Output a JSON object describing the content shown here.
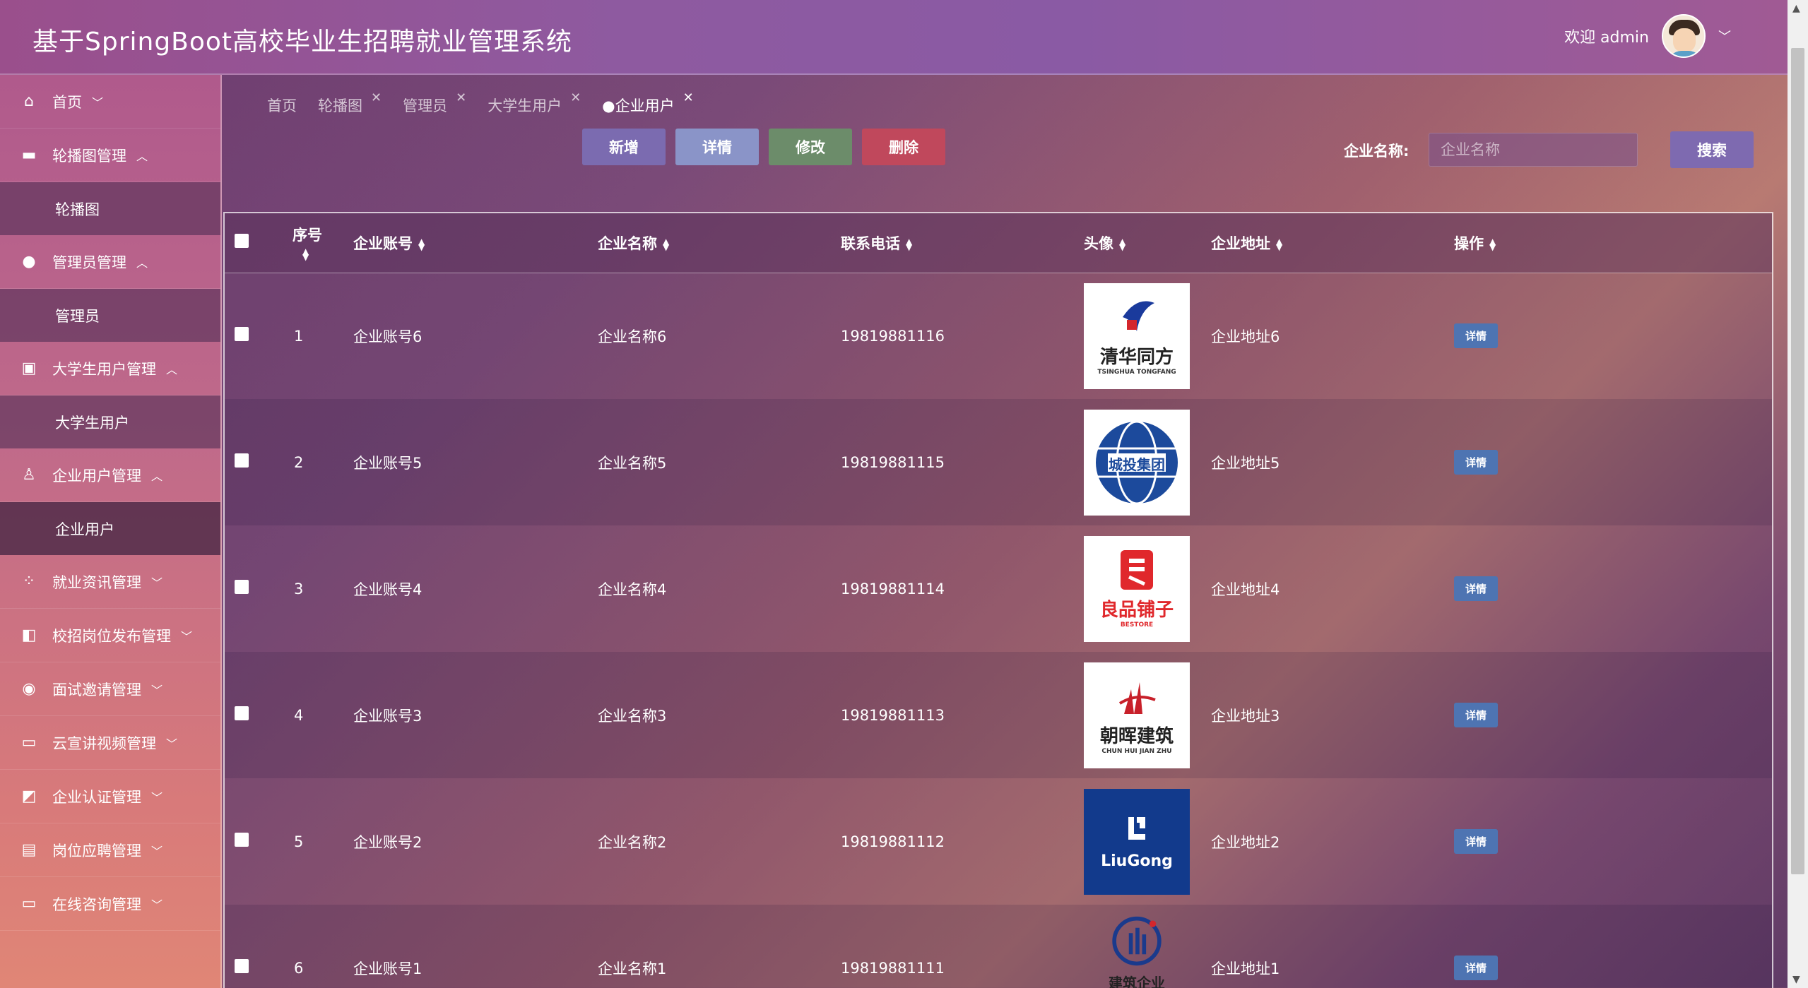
{
  "app": {
    "title": "基于SpringBoot高校毕业生招聘就业管理系统",
    "welcome": "欢迎 admin"
  },
  "sidebar": {
    "items": [
      {
        "label": "首页",
        "icon": "home-icon",
        "arrow": "﹀"
      },
      {
        "label": "轮播图管理",
        "icon": "image-icon",
        "arrow": "︿",
        "children": [
          "轮播图"
        ]
      },
      {
        "label": "管理员管理",
        "icon": "chat-bubble-icon",
        "arrow": "︿",
        "children": [
          "管理员"
        ]
      },
      {
        "label": "大学生用户管理",
        "icon": "chip-icon",
        "arrow": "︿",
        "children": [
          "大学生用户"
        ]
      },
      {
        "label": "企业用户管理",
        "icon": "user-icon",
        "arrow": "︿",
        "children": [
          "企业用户"
        ]
      },
      {
        "label": "就业资讯管理",
        "icon": "grid-icon",
        "arrow": "﹀"
      },
      {
        "label": "校招岗位发布管理",
        "icon": "columns-icon",
        "arrow": "﹀"
      },
      {
        "label": "面试邀请管理",
        "icon": "compass-icon",
        "arrow": "﹀"
      },
      {
        "label": "云宣讲视频管理",
        "icon": "wallet-icon",
        "arrow": "﹀"
      },
      {
        "label": "企业认证管理",
        "icon": "certificate-icon",
        "arrow": "﹀"
      },
      {
        "label": "岗位应聘管理",
        "icon": "book-icon",
        "arrow": "﹀"
      },
      {
        "label": "在线咨询管理",
        "icon": "card-icon",
        "arrow": "﹀"
      }
    ]
  },
  "tabs": [
    {
      "label": "首页",
      "closable": false
    },
    {
      "label": "轮播图",
      "closable": true
    },
    {
      "label": "管理员",
      "closable": true
    },
    {
      "label": "大学生用户",
      "closable": true
    },
    {
      "label": "●企业用户",
      "closable": true,
      "active": true
    }
  ],
  "toolbar": {
    "add": "新增",
    "detail": "详情",
    "edit": "修改",
    "delete": "删除"
  },
  "search": {
    "label": "企业名称:",
    "placeholder": "企业名称",
    "button": "搜索"
  },
  "table": {
    "headers": [
      "序号",
      "企业账号",
      "企业名称",
      "联系电话",
      "头像",
      "企业地址",
      "操作"
    ],
    "row_button": "详情",
    "rows": [
      {
        "index": "1",
        "account": "企业账号6",
        "name": "企业名称6",
        "phone": "19819881116",
        "address": "企业地址6",
        "logo_text": "清华同方",
        "logo_sub": "TSINGHUA TONGFANG",
        "logo_icon": "tsinghua-tongfang-logo"
      },
      {
        "index": "2",
        "account": "企业账号5",
        "name": "企业名称5",
        "phone": "19819881115",
        "address": "企业地址5",
        "logo_text": "城投集团",
        "logo_sub": "",
        "logo_icon": "chengtou-globe-logo"
      },
      {
        "index": "3",
        "account": "企业账号4",
        "name": "企业名称4",
        "phone": "19819881114",
        "address": "企业地址4",
        "logo_text": "良品铺子",
        "logo_sub": "BESTORE",
        "logo_icon": "bestore-logo"
      },
      {
        "index": "4",
        "account": "企业账号3",
        "name": "企业名称3",
        "phone": "19819881113",
        "address": "企业地址3",
        "logo_text": "朝晖建筑",
        "logo_sub": "CHUN HUI JIAN ZHU",
        "logo_icon": "chaohui-building-logo"
      },
      {
        "index": "5",
        "account": "企业账号2",
        "name": "企业名称2",
        "phone": "19819881112",
        "address": "企业地址2",
        "logo_text": "LiuGong",
        "logo_sub": "",
        "logo_icon": "liugong-logo"
      },
      {
        "index": "6",
        "account": "企业账号1",
        "name": "企业名称1",
        "phone": "19819881111",
        "address": "企业地址1",
        "logo_text": "建筑企业",
        "logo_sub": "",
        "logo_icon": "building-company-logo"
      }
    ]
  }
}
